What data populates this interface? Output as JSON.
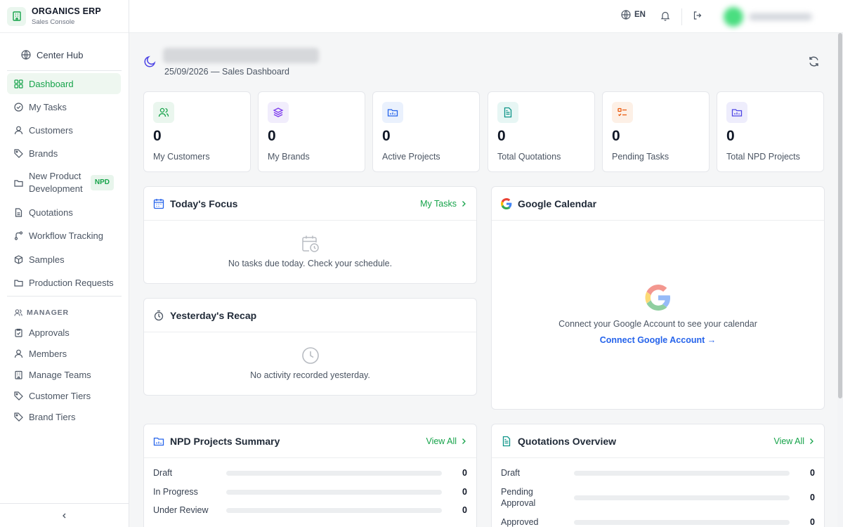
{
  "brand": {
    "title": "ORGANICS ERP",
    "subtitle": "Sales Console"
  },
  "center_hub": "Center Hub",
  "nav": [
    {
      "label": "Dashboard",
      "icon": "dashboard-icon",
      "active": true
    },
    {
      "label": "My Tasks",
      "icon": "check-circle-icon"
    },
    {
      "label": "Customers",
      "icon": "user-icon"
    },
    {
      "label": "Brands",
      "icon": "tag-icon"
    },
    {
      "label": "New Product Development",
      "icon": "folder-icon",
      "badge": "NPD"
    },
    {
      "label": "Quotations",
      "icon": "document-icon"
    },
    {
      "label": "Workflow Tracking",
      "icon": "workflow-icon"
    },
    {
      "label": "Samples",
      "icon": "package-icon"
    },
    {
      "label": "Production Requests",
      "icon": "folder-icon"
    }
  ],
  "manager_section": {
    "label": "MANAGER",
    "items": [
      {
        "label": "Approvals",
        "icon": "clipboard-icon"
      },
      {
        "label": "Members",
        "icon": "user-icon"
      },
      {
        "label": "Manage Teams",
        "icon": "building-icon"
      },
      {
        "label": "Customer Tiers",
        "icon": "tag-icon"
      },
      {
        "label": "Brand Tiers",
        "icon": "tag-icon"
      }
    ]
  },
  "topbar": {
    "language": "EN"
  },
  "header": {
    "subtitle": "25/09/2026 — Sales Dashboard"
  },
  "stats": [
    {
      "value": "0",
      "label": "My Customers",
      "icon": "users-icon",
      "color": "#16a34a"
    },
    {
      "value": "0",
      "label": "My Brands",
      "icon": "layers-icon",
      "color": "#7c3aed"
    },
    {
      "value": "0",
      "label": "Active Projects",
      "icon": "folder-chart-icon",
      "color": "#2563eb"
    },
    {
      "value": "0",
      "label": "Total Quotations",
      "icon": "document-icon",
      "color": "#0d9488"
    },
    {
      "value": "0",
      "label": "Pending Tasks",
      "icon": "list-check-icon",
      "color": "#ea580c"
    },
    {
      "value": "0",
      "label": "Total NPD Projects",
      "icon": "folder-chart-icon",
      "color": "#4f46e5"
    }
  ],
  "todays_focus": {
    "title": "Today's Focus",
    "link": "My Tasks",
    "empty": "No tasks due today. Check your schedule."
  },
  "yesterdays_recap": {
    "title": "Yesterday's Recap",
    "empty": "No activity recorded yesterday."
  },
  "google_calendar": {
    "title": "Google Calendar",
    "message": "Connect your Google Account to see your calendar",
    "link": "Connect Google Account →"
  },
  "npd_summary": {
    "title": "NPD Projects Summary",
    "link": "View All",
    "rows": [
      {
        "label": "Draft",
        "value": "0",
        "fill": 0
      },
      {
        "label": "In Progress",
        "value": "0",
        "fill": 0
      },
      {
        "label": "Under Review",
        "value": "0",
        "fill": 0
      }
    ]
  },
  "quotations_overview": {
    "title": "Quotations Overview",
    "link": "View All",
    "rows": [
      {
        "label": "Draft",
        "value": "0",
        "fill": 0
      },
      {
        "label": "Pending Approval",
        "value": "0",
        "fill": 0
      },
      {
        "label": "Approved",
        "value": "0",
        "fill": 0
      }
    ]
  },
  "colors": {
    "accent": "#16a34a",
    "link_blue": "#2563eb"
  }
}
